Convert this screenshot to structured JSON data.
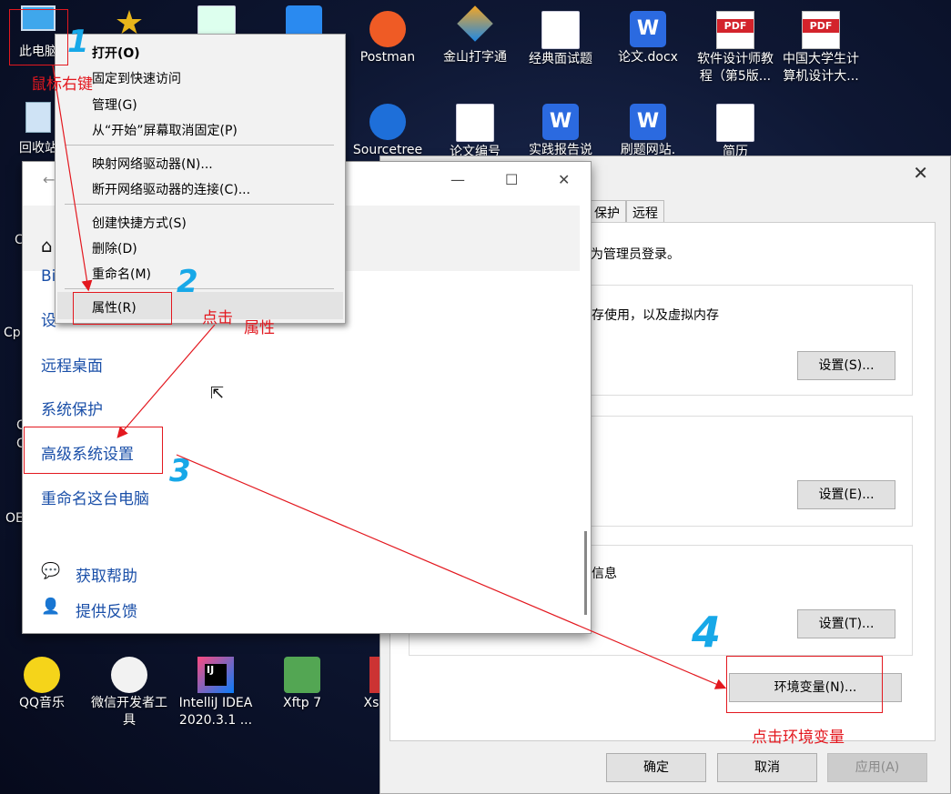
{
  "desktop": {
    "icons_top": [
      {
        "key": "this_pc",
        "label": "此电脑"
      },
      {
        "key": "postman",
        "label": "Postman"
      },
      {
        "key": "wps",
        "label": "金山打字通"
      },
      {
        "key": "interview",
        "label": "经典面试题"
      },
      {
        "key": "thesis_docx",
        "label": "论文.docx"
      },
      {
        "key": "sw_designer",
        "label": "软件设计师教程（第5版..."
      },
      {
        "key": "pdf_cn",
        "label": "中国大学生计算机设计大..."
      }
    ],
    "icons_second": [
      {
        "key": "recycle",
        "label": "回收站"
      },
      {
        "key": "sourcetree",
        "label": "Sourcetree"
      },
      {
        "key": "thesis_num",
        "label": "论文编号"
      },
      {
        "key": "practice",
        "label": "实践报告说"
      },
      {
        "key": "shuati",
        "label": "刷题网站."
      },
      {
        "key": "resume",
        "label": "简历"
      }
    ],
    "icons_bottom": [
      {
        "key": "qqmusic",
        "label": "QQ音乐"
      },
      {
        "key": "wechat_dev",
        "label": "微信开发者工具"
      },
      {
        "key": "idea",
        "label": "IntelliJ IDEA 2020.3.1 ..."
      },
      {
        "key": "xftp",
        "label": "Xftp 7"
      },
      {
        "key": "xshell",
        "label": "Xs"
      }
    ],
    "edge_fragments": [
      "C",
      "Cp",
      "C",
      "C",
      "OE"
    ]
  },
  "context_menu": {
    "items": [
      {
        "label": "打开(O)",
        "bold": true
      },
      {
        "label": "固定到快速访问"
      },
      {
        "label": "管理(G)"
      },
      {
        "label": "从“开始”屏幕取消固定(P)"
      },
      {
        "label": "映射网络驱动器(N)..."
      },
      {
        "label": "断开网络驱动器的连接(C)..."
      },
      {
        "label": "创建快捷方式(S)"
      },
      {
        "label": "删除(D)"
      },
      {
        "label": "重命名(M)"
      },
      {
        "label": "属性(R)"
      }
    ]
  },
  "about_window": {
    "links": {
      "bi": "Bi",
      "settings": "设",
      "remote": "远程桌面",
      "protection": "系统保护",
      "advanced": "高级系统设置",
      "rename": "重命名这台电脑"
    },
    "help": "获取帮助",
    "feedback": "提供反馈"
  },
  "system_properties": {
    "tabs": [
      "保护",
      "远程"
    ],
    "admin_note": "为管理员登录。",
    "perf_text": "存使用，以及虚拟内存",
    "startup_text": "信息",
    "btn_perf": "设置(S)...",
    "btn_profile": "设置(E)...",
    "btn_startup": "设置(T)...",
    "btn_env": "环境变量(N)...",
    "btn_ok": "确定",
    "btn_cancel": "取消",
    "btn_apply": "应用(A)"
  },
  "annotations": {
    "right_click": "鼠标右键",
    "click": "点击",
    "property": "属性",
    "click_env": "点击环境变量",
    "step1": "1",
    "step2": "2",
    "step3": "3",
    "step4": "4"
  },
  "colors": {
    "annotation_red": "#e3181f",
    "annotation_blue": "#17a8e8",
    "link_blue": "#1a4fa8"
  }
}
